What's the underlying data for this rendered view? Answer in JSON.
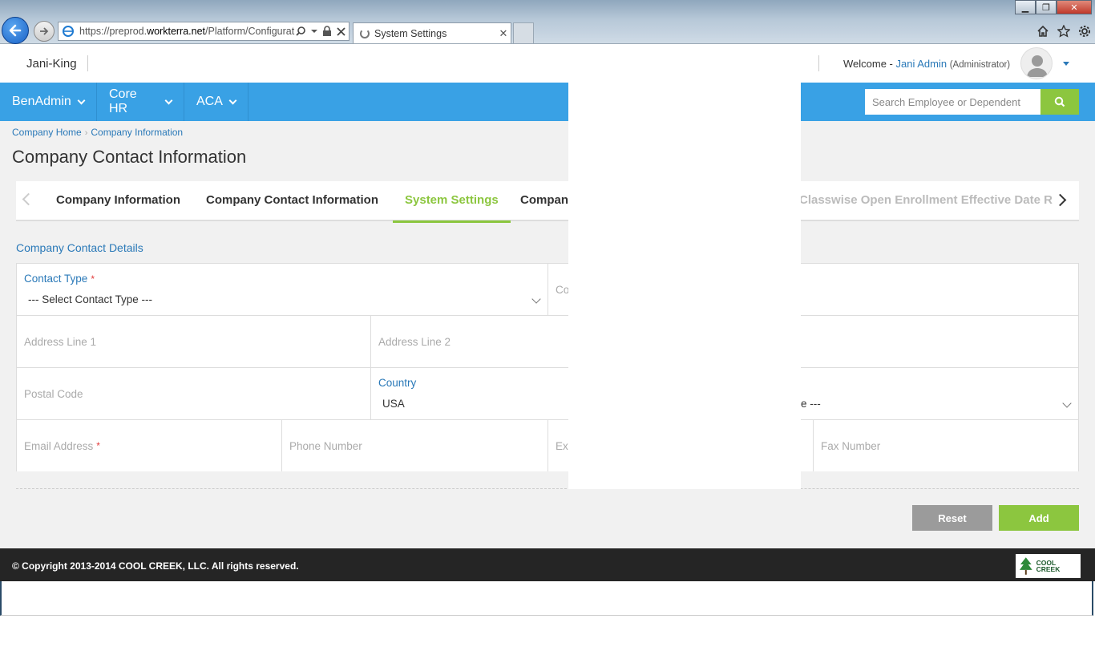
{
  "browser": {
    "url_prefix": "https://preprod.",
    "url_domain": "workterra.net",
    "url_rest": "/Platform/Configurat",
    "tab_title": "System Settings",
    "tab_close": "✕"
  },
  "header": {
    "brand": "Jani-King",
    "welcome_prefix": "Welcome - ",
    "user_name": "Jani Admin",
    "user_role": "(Administrator)"
  },
  "nav": {
    "items": [
      {
        "label": "BenAdmin"
      },
      {
        "label": "Core HR"
      },
      {
        "label": "ACA"
      }
    ],
    "search_placeholder": "Search Employee or Dependent",
    "accent": "#39a1e5",
    "search_button_color": "#8cc63f"
  },
  "breadcrumb": [
    "Company Home",
    "Company Information"
  ],
  "page_title": "Company Contact Information",
  "tabs": [
    {
      "label": "Company Information",
      "active": false
    },
    {
      "label": "Company Contact Information",
      "active": false
    },
    {
      "label": "System Settings",
      "active": true
    },
    {
      "label": "Compan",
      "active": false
    },
    {
      "label": "Classwise Open Enrollment Effective Date R",
      "active": false
    }
  ],
  "form": {
    "section_title": "Company Contact Details",
    "contact_type_label": "Contact Type",
    "contact_type_value": "--- Select Contact Type ---",
    "contact_name_partial": "Co",
    "address1_placeholder": "Address Line 1",
    "address2_placeholder": "Address Line 2",
    "postal_placeholder": "Postal Code",
    "country_label": "Country",
    "country_value": "USA",
    "state_partial": "e ---",
    "email_placeholder": "Email Address",
    "phone_placeholder": "Phone Number",
    "ext_partial": "Ext",
    "fax_placeholder": "Fax Number",
    "required_mark": "*"
  },
  "buttons": {
    "reset": "Reset",
    "add": "Add"
  },
  "footer": {
    "copyright": "© Copyright 2013-2014 COOL CREEK, LLC. All rights reserved.",
    "logo_text": "COOL CREEK"
  }
}
